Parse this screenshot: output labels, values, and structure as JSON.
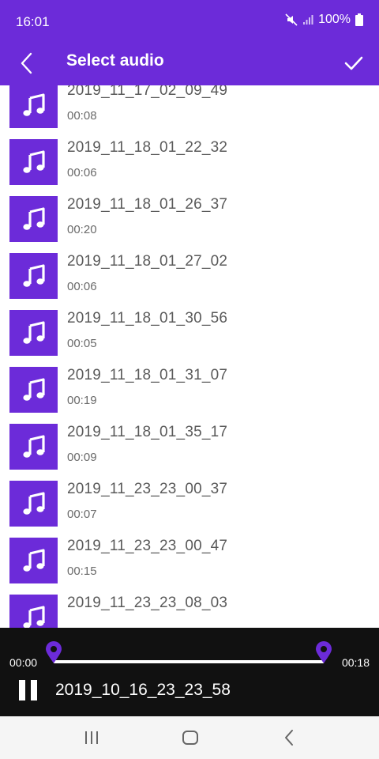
{
  "status_bar": {
    "time": "16:01",
    "battery_text": "100%",
    "icons": [
      "mute-icon",
      "signal-icon",
      "battery-icon"
    ]
  },
  "app_bar": {
    "title": "Select audio",
    "back_icon": "chevron-left-icon",
    "confirm_icon": "check-icon"
  },
  "audio_list": [
    {
      "name": "2019_11_17_02_09_49",
      "duration": "00:08"
    },
    {
      "name": "2019_11_18_01_22_32",
      "duration": "00:06"
    },
    {
      "name": "2019_11_18_01_26_37",
      "duration": "00:20"
    },
    {
      "name": "2019_11_18_01_27_02",
      "duration": "00:06"
    },
    {
      "name": "2019_11_18_01_30_56",
      "duration": "00:05"
    },
    {
      "name": "2019_11_18_01_31_07",
      "duration": "00:19"
    },
    {
      "name": "2019_11_18_01_35_17",
      "duration": "00:09"
    },
    {
      "name": "2019_11_23_23_00_37",
      "duration": "00:07"
    },
    {
      "name": "2019_11_23_23_00_47",
      "duration": "00:15"
    },
    {
      "name": "2019_11_23_23_08_03",
      "duration": ""
    }
  ],
  "player": {
    "start_time": "00:00",
    "end_time": "00:18",
    "now_playing": "2019_10_16_23_23_58",
    "state_icon": "pause-icon"
  },
  "colors": {
    "accent": "#6c2bd9",
    "player_bg": "#111111",
    "text_secondary": "#5a5a5a"
  }
}
